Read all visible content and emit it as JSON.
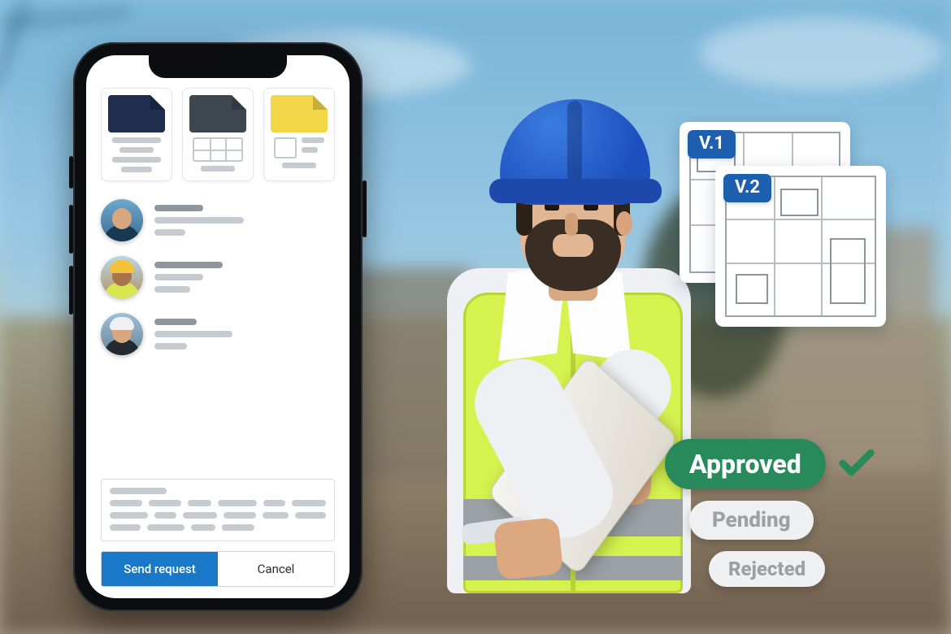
{
  "phone": {
    "docs": [
      {
        "name": "doc-text",
        "color": "c-navy"
      },
      {
        "name": "doc-table",
        "color": "c-slate"
      },
      {
        "name": "doc-layout",
        "color": "c-yellow"
      }
    ],
    "people": [
      {
        "name": "person-1"
      },
      {
        "name": "person-2"
      },
      {
        "name": "person-3"
      }
    ],
    "actions": {
      "primary_label": "Send request",
      "secondary_label": "Cancel"
    }
  },
  "plans": {
    "v1_label": "V.1",
    "v2_label": "V.2"
  },
  "status": {
    "approved_label": "Approved",
    "pending_label": "Pending",
    "rejected_label": "Rejected"
  },
  "colors": {
    "primary_blue": "#1978c8",
    "approved_green": "#28895a",
    "version_tag_blue": "#1f5fb0"
  }
}
